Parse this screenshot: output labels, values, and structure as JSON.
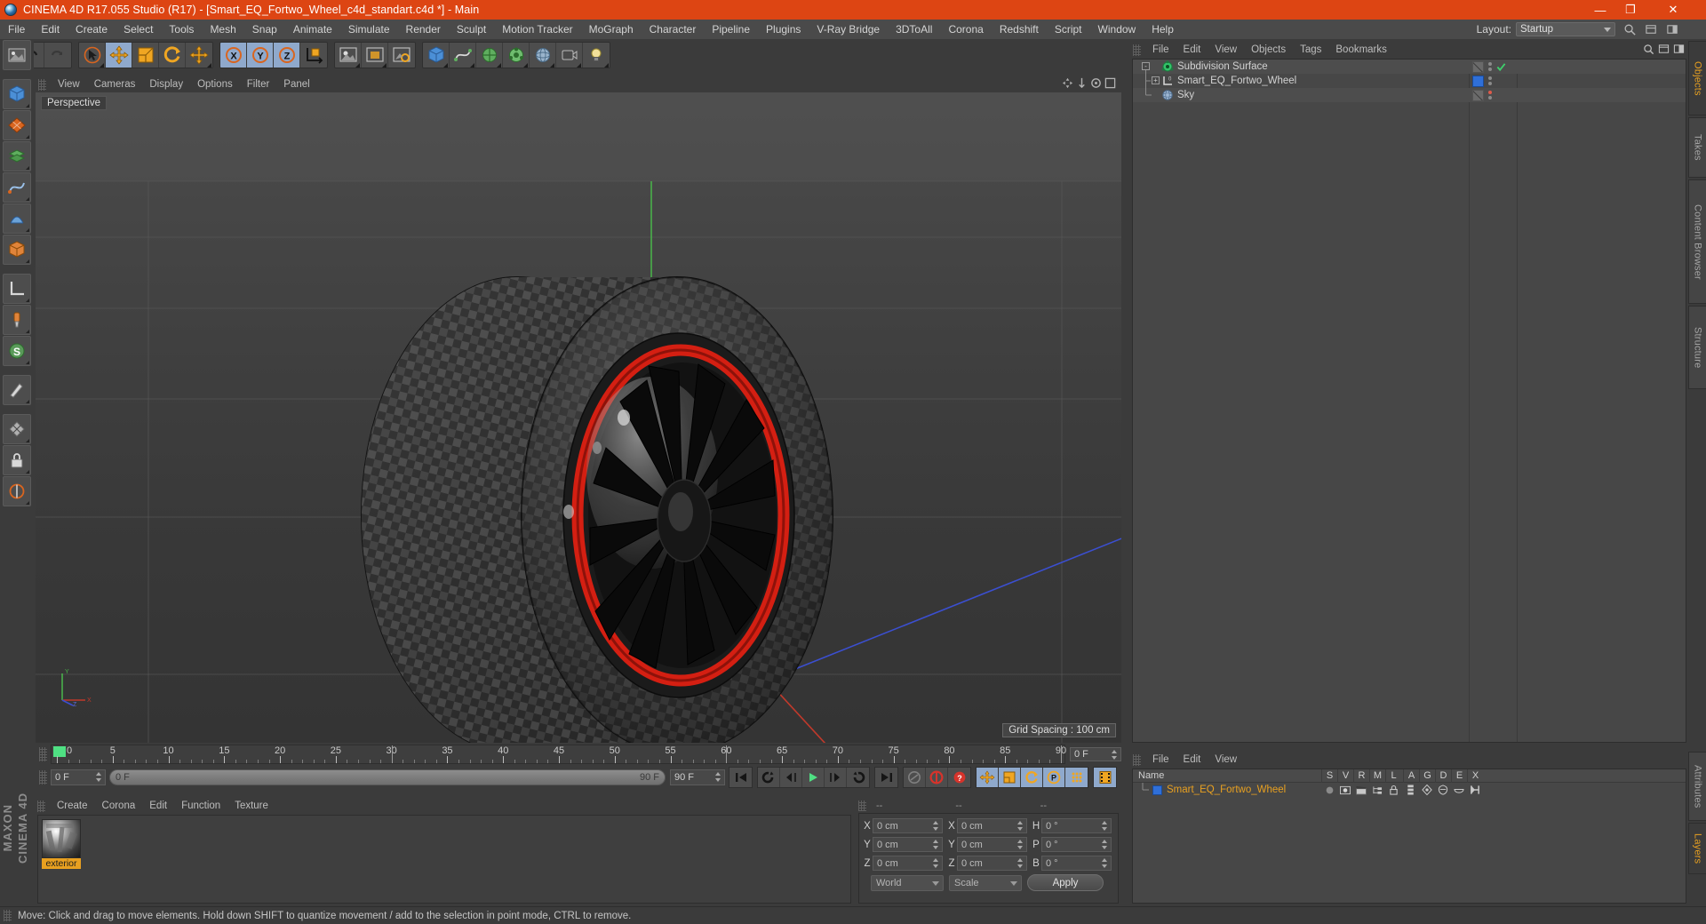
{
  "window": {
    "title": "CINEMA 4D R17.055 Studio (R17) - [Smart_EQ_Fortwo_Wheel_c4d_standart.c4d *] - Main",
    "minimize": "—",
    "maximize": "❐",
    "close": "✕"
  },
  "menubar": {
    "items": [
      {
        "label": "File"
      },
      {
        "label": "Edit"
      },
      {
        "label": "Create"
      },
      {
        "label": "Select"
      },
      {
        "label": "Tools"
      },
      {
        "label": "Mesh"
      },
      {
        "label": "Snap"
      },
      {
        "label": "Animate"
      },
      {
        "label": "Simulate"
      },
      {
        "label": "Render"
      },
      {
        "label": "Sculpt"
      },
      {
        "label": "Motion Tracker"
      },
      {
        "label": "MoGraph"
      },
      {
        "label": "Character"
      },
      {
        "label": "Pipeline"
      },
      {
        "label": "Plugins"
      },
      {
        "label": "V-Ray Bridge"
      },
      {
        "label": "3DToAll"
      },
      {
        "label": "Corona"
      },
      {
        "label": "Redshift"
      },
      {
        "label": "Script"
      },
      {
        "label": "Window"
      },
      {
        "label": "Help"
      }
    ],
    "layout_label": "Layout:",
    "layout_value": "Startup"
  },
  "viewport": {
    "menus": [
      {
        "label": "View"
      },
      {
        "label": "Cameras"
      },
      {
        "label": "Display"
      },
      {
        "label": "Options"
      },
      {
        "label": "Filter"
      },
      {
        "label": "Panel"
      }
    ],
    "view_label": "Perspective",
    "grid_spacing": "Grid Spacing : 100 cm",
    "axis_x": "X",
    "axis_y": "Y",
    "axis_z": "Z"
  },
  "timeline": {
    "current_frame": "0 F",
    "end_marker": "0 F",
    "ticks": [
      {
        "label": "0",
        "value": 0
      },
      {
        "label": "5",
        "value": 5
      },
      {
        "label": "10",
        "value": 10
      },
      {
        "label": "15",
        "value": 15
      },
      {
        "label": "20",
        "value": 20
      },
      {
        "label": "25",
        "value": 25
      },
      {
        "label": "30",
        "value": 30
      },
      {
        "label": "35",
        "value": 35
      },
      {
        "label": "40",
        "value": 40
      },
      {
        "label": "45",
        "value": 45
      },
      {
        "label": "50",
        "value": 50
      },
      {
        "label": "55",
        "value": 55
      },
      {
        "label": "60",
        "value": 60
      },
      {
        "label": "65",
        "value": 65
      },
      {
        "label": "70",
        "value": 70
      },
      {
        "label": "75",
        "value": 75
      },
      {
        "label": "80",
        "value": 80
      },
      {
        "label": "85",
        "value": 85
      },
      {
        "label": "90",
        "value": 90
      }
    ],
    "range_min": 0,
    "range_max": 90
  },
  "playbar": {
    "start_frame": "0 F",
    "slider_value": "0 F",
    "slider_end": "90 F",
    "end_frame": "90 F"
  },
  "material_manager": {
    "menus": [
      {
        "label": "Create"
      },
      {
        "label": "Corona"
      },
      {
        "label": "Edit"
      },
      {
        "label": "Function"
      },
      {
        "label": "Texture"
      }
    ],
    "materials": [
      {
        "name": "exterior"
      }
    ]
  },
  "coordinate_manager": {
    "header_dashes": [
      "--",
      "--",
      "--"
    ],
    "rows": [
      {
        "pos_label": "X",
        "pos_value": "0 cm",
        "size_label": "X",
        "size_value": "0 cm",
        "rot_label": "H",
        "rot_value": "0 °"
      },
      {
        "pos_label": "Y",
        "pos_value": "0 cm",
        "size_label": "Y",
        "size_value": "0 cm",
        "rot_label": "P",
        "rot_value": "0 °"
      },
      {
        "pos_label": "Z",
        "pos_value": "0 cm",
        "size_label": "Z",
        "size_value": "0 cm",
        "rot_label": "B",
        "rot_value": "0 °"
      }
    ],
    "coord_system": "World",
    "transform_mode": "Scale",
    "apply_label": "Apply"
  },
  "object_manager": {
    "menus": [
      {
        "label": "File"
      },
      {
        "label": "Edit"
      },
      {
        "label": "View"
      },
      {
        "label": "Objects"
      },
      {
        "label": "Tags"
      },
      {
        "label": "Bookmarks"
      }
    ],
    "objects": [
      {
        "name": "Subdivision Surface",
        "depth": 0,
        "icon": "subdivision-surface-icon",
        "has_check": true,
        "dot_color": "#8a8a8a",
        "has_tagbox": true,
        "swatch": null
      },
      {
        "name": "Smart_EQ_Fortwo_Wheel",
        "depth": 1,
        "icon": "null-object-icon",
        "has_check": false,
        "dot_color": "#8a8a8a",
        "has_tagbox": false,
        "swatch": "#2f6fd8"
      },
      {
        "name": "Sky",
        "depth": 1,
        "icon": "sky-object-icon",
        "has_check": false,
        "dot_color": "#e05a4a",
        "has_tagbox": true,
        "swatch": null
      }
    ]
  },
  "layer_manager": {
    "menus": [
      {
        "label": "File"
      },
      {
        "label": "Edit"
      },
      {
        "label": "View"
      }
    ],
    "name_column": "Name",
    "columns": [
      "S",
      "V",
      "R",
      "M",
      "L",
      "A",
      "G",
      "D",
      "E",
      "X"
    ],
    "rows": [
      {
        "name": "Smart_EQ_Fortwo_Wheel",
        "color": "#2f6fd8",
        "text_color": "#e8a020"
      }
    ]
  },
  "right_tabs_top": [
    {
      "label": "Objects",
      "active": true
    },
    {
      "label": "Takes",
      "active": false
    },
    {
      "label": "Content Browser",
      "active": false
    },
    {
      "label": "Structure",
      "active": false
    }
  ],
  "right_tabs_bottom": [
    {
      "label": "Attributes",
      "active": false
    },
    {
      "label": "Layers",
      "active": true
    }
  ],
  "brand": {
    "maxon": "MAXON",
    "cinema4d": "CINEMA 4D"
  },
  "statusbar": {
    "message": "Move: Click and drag to move elements. Hold down SHIFT to quantize movement / add to the selection in point mode, CTRL to remove."
  },
  "colors": {
    "accent_orange": "#dd4513",
    "highlight_orange": "#e8a020",
    "panel_bg": "#3b3b3b",
    "selected_blue": "#8fa9cc",
    "layer_blue": "#2f6fd8"
  }
}
